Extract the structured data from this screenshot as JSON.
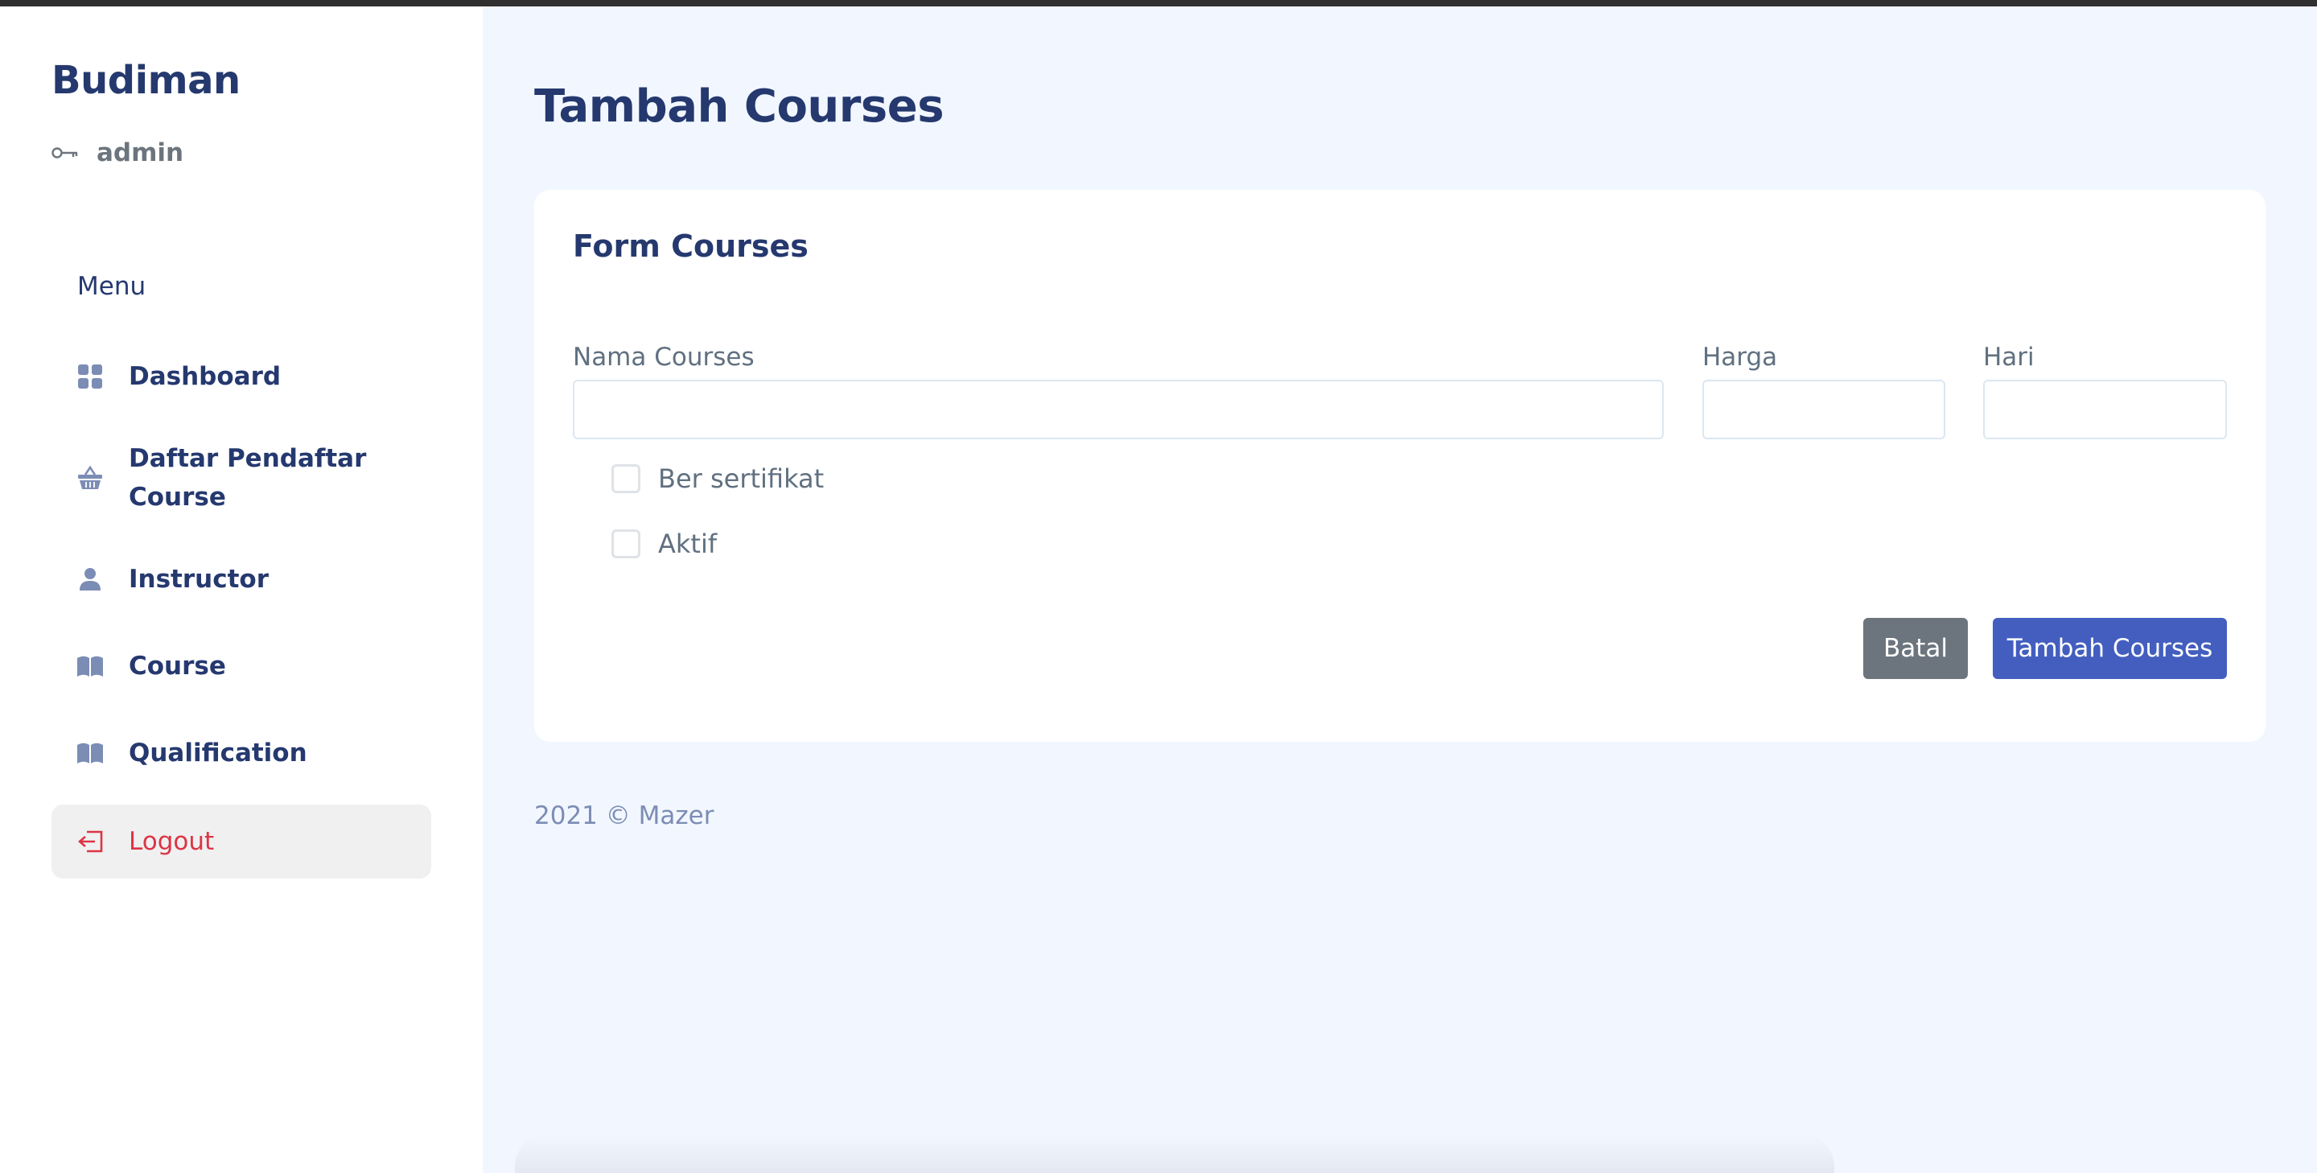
{
  "sidebar": {
    "brand": "Budiman",
    "role": "admin",
    "menu_title": "Menu",
    "items": [
      {
        "label": "Dashboard",
        "icon": "grid-icon"
      },
      {
        "label": "Daftar Pendaftar Course",
        "icon": "basket-icon"
      },
      {
        "label": "Instructor",
        "icon": "person-icon"
      },
      {
        "label": "Course",
        "icon": "book-icon"
      },
      {
        "label": "Qualification",
        "icon": "book-icon"
      },
      {
        "label": "Logout",
        "icon": "logout-icon"
      }
    ]
  },
  "page": {
    "title": "Tambah Courses"
  },
  "form": {
    "title": "Form Courses",
    "fields": {
      "nama_label": "Nama Courses",
      "nama_value": "",
      "harga_label": "Harga",
      "harga_value": "",
      "hari_label": "Hari",
      "hari_value": ""
    },
    "checkboxes": {
      "sertifikat_label": "Ber sertifikat",
      "sertifikat_checked": false,
      "aktif_label": "Aktif",
      "aktif_checked": false
    },
    "buttons": {
      "cancel": "Batal",
      "submit": "Tambah Courses"
    }
  },
  "footer": {
    "text": "2021 © Mazer"
  },
  "colors": {
    "primary": "#435ebe",
    "secondary": "#6c757d",
    "heading": "#25396f",
    "danger": "#dc3545",
    "icon": "#7c8db5",
    "background": "#f2f7ff"
  }
}
